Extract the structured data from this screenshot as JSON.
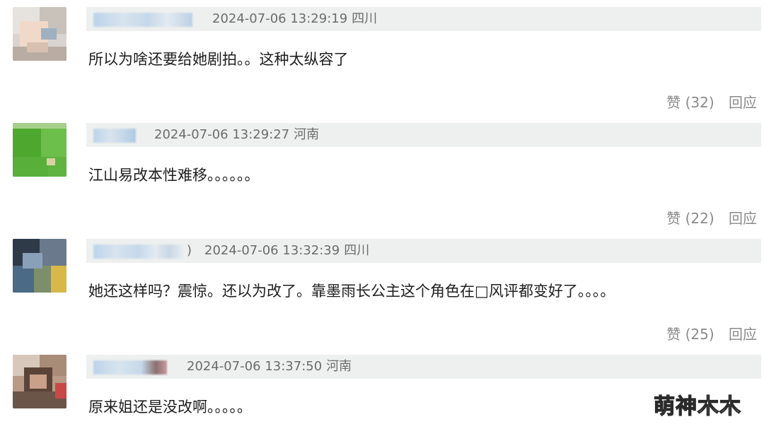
{
  "comments": [
    {
      "timestamp": "2024-07-06 13:29:19",
      "location": "四川",
      "text": "所以为啥还要给她剧拍。。这种太纵容了",
      "likes_label": "赞 (32)",
      "reply_label": "回应"
    },
    {
      "timestamp": "2024-07-06 13:29:27",
      "location": "河南",
      "text": "江山易改本性难移。。。。。。",
      "likes_label": "赞 (22)",
      "reply_label": "回应"
    },
    {
      "timestamp": "2024-07-06 13:32:39",
      "location": "四川",
      "name_suffix": ")",
      "text": "她还这样吗？震惊。还以为改了。靠墨雨长公主这个角色在□风评都变好了。。。。",
      "likes_label": "赞 (25)",
      "reply_label": "回应"
    },
    {
      "timestamp": "2024-07-06 13:37:50",
      "location": "河南",
      "text": "原来姐还是没改啊。。。。。"
    }
  ],
  "watermark": "萌神木木",
  "colors": {
    "meta_bar": "#eef0ef",
    "meta_text": "#6b6b6b",
    "body_text": "#1e1e1e",
    "action_text": "#8a8a8a"
  }
}
